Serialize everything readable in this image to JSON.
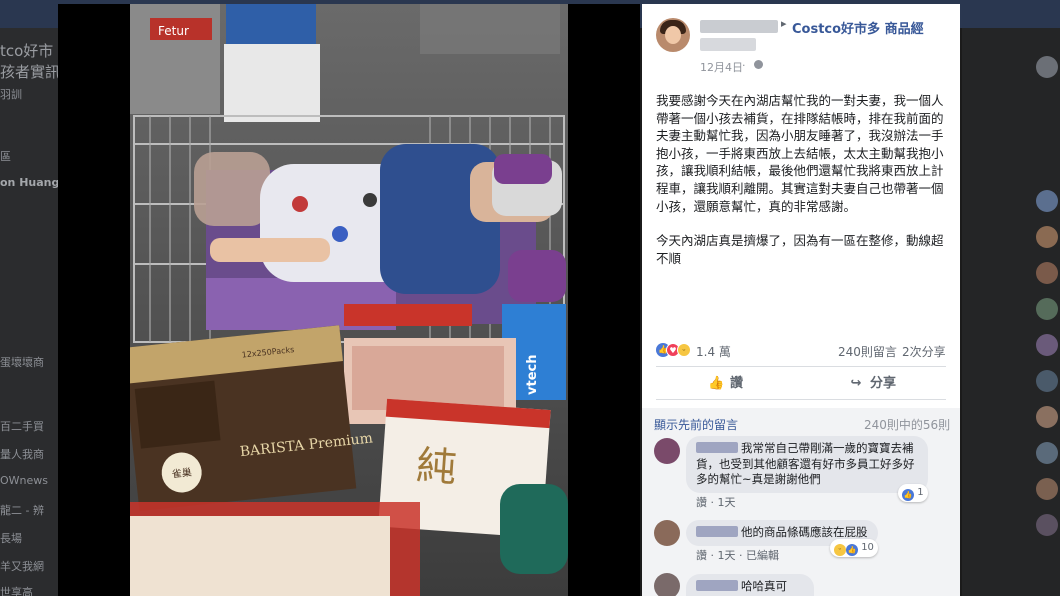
{
  "background": {
    "left_texts": [
      "tco好市",
      "孩者實訊",
      "羽訓",
      "區",
      "on Huang",
      "蛋壞壞商",
      "百二手買",
      "量人我商",
      "OWnews",
      "龍二 - 辨",
      "長場",
      "羊又我網",
      "世享高"
    ]
  },
  "post": {
    "group_name": "Costco好市多 商品經",
    "time": "12月4日",
    "dot": "·",
    "paragraphs": [
      "我要感謝今天在內湖店幫忙我的一對夫妻，我一個人帶著一個小孩去補貨，在排隊結帳時，排在我前面的夫妻主動幫忙我，因為小朋友睡著了，我沒辦法一手抱小孩，一手將東西放上去結帳，太太主動幫我抱小孩，讓我順利結帳，最後他們還幫忙我將東西放上計程車，讓我順利離開。其實這對夫妻自己也帶著一個小孩，還願意幫忙，真的非常感謝。",
      "今天內湖店真是擠爆了，因為有一區在整修，動線超不順"
    ],
    "reactions": {
      "count": "1.4 萬",
      "comments": "240則留言",
      "shares": "2次分享"
    },
    "actions": {
      "like": "讚",
      "share": "分享"
    },
    "icons": {
      "like": "thumbs-up-icon",
      "share": "share-arrow-icon",
      "globe": "globe-icon",
      "caret": "caret-right-icon"
    }
  },
  "comments": {
    "prev_link": "顯示先前的留言",
    "prev_count": "240則中的56則",
    "items": [
      {
        "text": "我常常自己帶剛滿一歲的寶寶去補貨，也受到其他顧客還有好市多員工好多好多的幫忙~真是謝謝他們",
        "meta_like": "讚",
        "meta_time": "1天",
        "reacts": "1"
      },
      {
        "text": "他的商品條碼應該在屁股",
        "meta_like": "讚",
        "meta_time": "1天",
        "meta_edit": "已編輯",
        "reacts": "10"
      },
      {
        "text": "哈哈真可愛。"
      }
    ]
  },
  "photo_labels": {
    "box1": "BARISTA Premium",
    "box1_brand": "雀巢",
    "box1_top": "12x250Packs",
    "vtech": "vtech",
    "pack": "純",
    "banner": "Fetur"
  },
  "colors": {
    "link": "#385898",
    "topbar": "#2a3750",
    "like": "#4a78d8"
  }
}
